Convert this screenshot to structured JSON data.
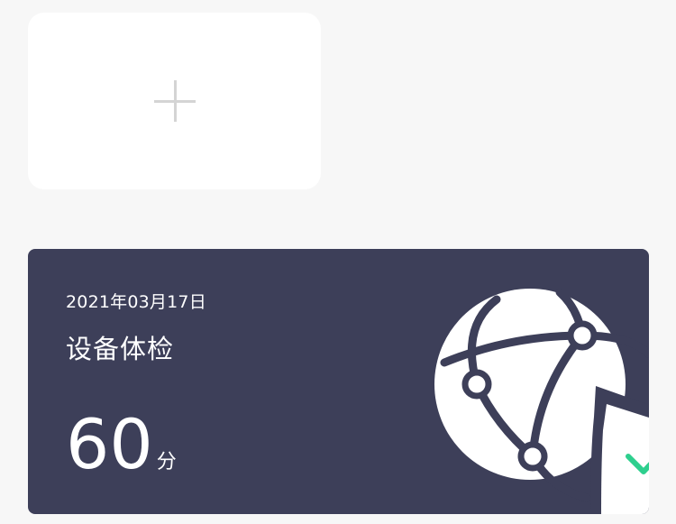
{
  "add_card": {
    "icon": "plus-icon"
  },
  "check_card": {
    "date": "2021年03月17日",
    "title": "设备体检",
    "score": "60",
    "score_unit": "分",
    "illustration_icon": "globe-network-shield-check-icon",
    "colors": {
      "card_background": "#3d3f59",
      "check_mark": "#2ecf8e",
      "text": "#ffffff"
    }
  }
}
